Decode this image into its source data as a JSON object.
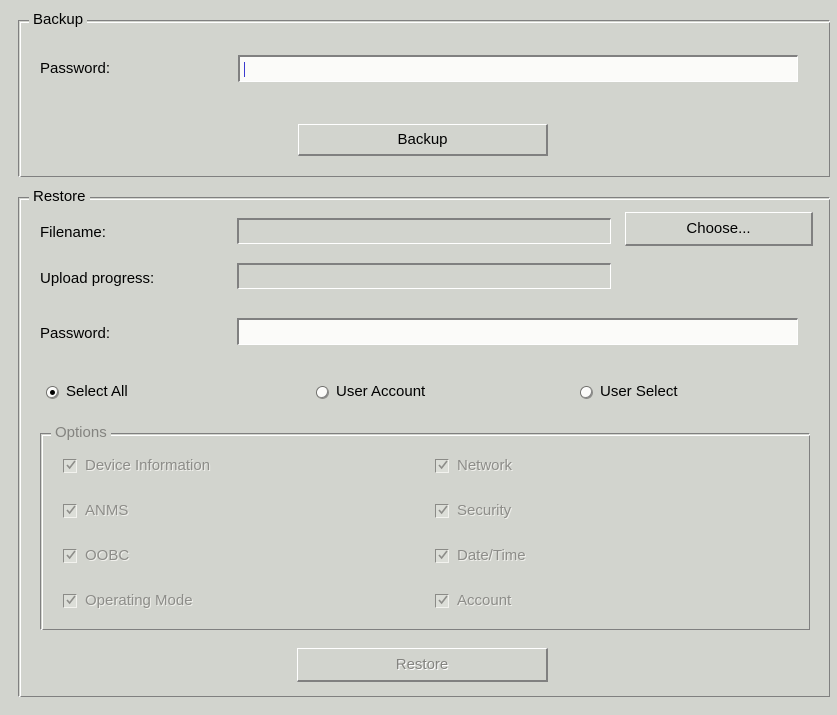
{
  "backup": {
    "title": "Backup",
    "password_label": "Password:",
    "password_value": "",
    "password_placeholder": "",
    "backup_button": "Backup"
  },
  "restore": {
    "title": "Restore",
    "filename_label": "Filename:",
    "filename_value": "",
    "upload_progress_label": "Upload progress:",
    "upload_progress_value": "",
    "choose_button": "Choose...",
    "password_label": "Password:",
    "password_value": "",
    "scope_options": [
      {
        "label": "Select All",
        "selected": true
      },
      {
        "label": "User Account",
        "selected": false
      },
      {
        "label": "User Select",
        "selected": false
      }
    ],
    "options": {
      "title": "Options",
      "items": [
        {
          "label": "Device Information",
          "checked": true,
          "enabled": false
        },
        {
          "label": "Network",
          "checked": true,
          "enabled": false
        },
        {
          "label": "ANMS",
          "checked": true,
          "enabled": false
        },
        {
          "label": "Security",
          "checked": true,
          "enabled": false
        },
        {
          "label": "OOBC",
          "checked": true,
          "enabled": false
        },
        {
          "label": "Date/Time",
          "checked": true,
          "enabled": false
        },
        {
          "label": "Operating Mode",
          "checked": true,
          "enabled": false
        },
        {
          "label": "Account",
          "checked": true,
          "enabled": false
        }
      ]
    },
    "restore_button": "Restore"
  },
  "colors": {
    "window_background": "#d2d4ce",
    "field_background": "#fbfbf9",
    "field_disabled_background": "#d2d4ce",
    "shadow": "#808080",
    "highlight": "#ffffff",
    "disabled_text": "#848480",
    "text": "#000000",
    "caret": "#3a3ad0"
  }
}
